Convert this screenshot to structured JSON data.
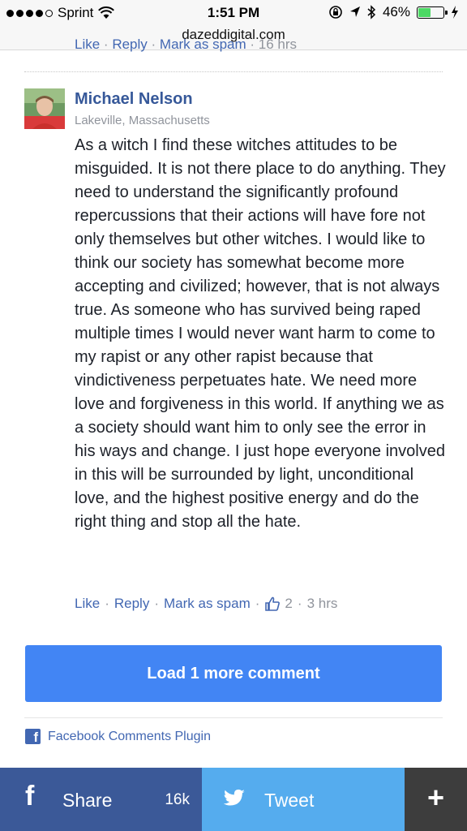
{
  "status_bar": {
    "carrier": "Sprint",
    "time": "1:51 PM",
    "battery": "46%",
    "battery_level": 0.46,
    "icons": [
      "signal-dots",
      "wifi-icon",
      "orientation-lock-icon",
      "location-arrow-icon",
      "bluetooth-icon",
      "battery-icon",
      "charging-bolt-icon"
    ]
  },
  "url_bar": {
    "url": "dazeddigital.com"
  },
  "previous_comment_actions": {
    "like": "Like",
    "reply": "Reply",
    "mark_spam": "Mark as spam",
    "time": "16 hrs"
  },
  "comment": {
    "author": "Michael Nelson",
    "location": "Lakeville, Massachusetts",
    "text": "As a witch I find these witches attitudes to be misguided. It is not there place to do anything. They need to understand the significantly profound repercussions that their actions will have fore not only themselves but other witches. I would like to think our society has somewhat become more accepting and civilized; however, that is not always true. As someone who has survived being raped multiple times I would never want harm to come to my rapist or any other rapist because that vindictiveness perpetuates hate. We need more love and forgiveness in this world. If anything we as a society should want him to only see the error in his ways and change. I just hope everyone involved in this will be surrounded by light, unconditional love, and the highest positive energy and do the right thing and stop all the hate.",
    "actions": {
      "like": "Like",
      "reply": "Reply",
      "mark_spam": "Mark as spam",
      "like_count": "2",
      "time": "3 hrs"
    }
  },
  "load_more": {
    "label": "Load 1 more comment"
  },
  "plugin": {
    "label": "Facebook Comments Plugin"
  },
  "share_bar": {
    "facebook": {
      "label": "Share",
      "count": "16k",
      "icon": "f",
      "color": "#3b5998"
    },
    "twitter": {
      "label": "Tweet",
      "color": "#55acee"
    },
    "more": {
      "label": "+",
      "color": "#3d3d3d"
    }
  }
}
